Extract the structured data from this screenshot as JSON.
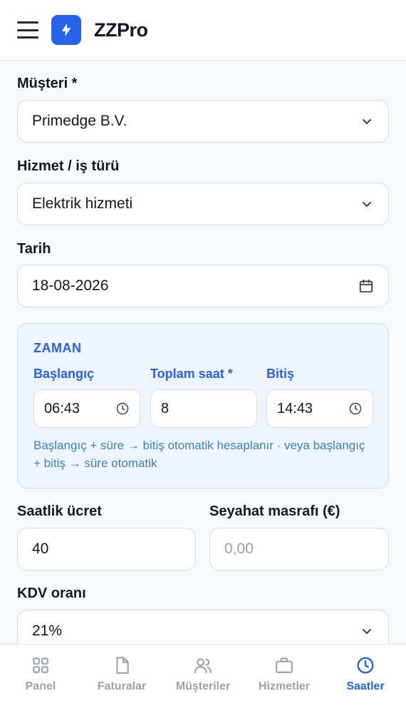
{
  "header": {
    "brand": "ZZPro"
  },
  "form": {
    "customer": {
      "label": "Müşteri *",
      "value": "Primedge B.V."
    },
    "service": {
      "label": "Hizmet / iş türü",
      "value": "Elektrik hizmeti"
    },
    "date": {
      "label": "Tarih",
      "value": "18-08-2026"
    },
    "time": {
      "title": "ZAMAN",
      "start": {
        "label": "Başlangıç",
        "value": "06:43"
      },
      "total": {
        "label": "Toplam saat *",
        "value": "8"
      },
      "end": {
        "label": "Bitiş",
        "value": "14:43"
      },
      "hint": "Başlangıç + süre → bitiş otomatik hesaplanır · veya başlangıç + bitiş → süre otomatik"
    },
    "hourly_rate": {
      "label": "Saatlik ücret",
      "value": "40"
    },
    "travel_cost": {
      "label": "Seyahat masrafı (€)",
      "placeholder": "0,00"
    },
    "vat": {
      "label": "KDV oranı",
      "value": "21%"
    }
  },
  "nav": {
    "items": [
      {
        "label": "Panel",
        "icon": "grid-icon"
      },
      {
        "label": "Faturalar",
        "icon": "document-icon"
      },
      {
        "label": "Müşteriler",
        "icon": "users-icon"
      },
      {
        "label": "Hizmetler",
        "icon": "briefcase-icon"
      },
      {
        "label": "Saatler",
        "icon": "clock-icon",
        "active": true
      }
    ]
  },
  "colors": {
    "accent": "#2563eb",
    "muted": "#9ca3af",
    "panel": "#eef4fd"
  }
}
